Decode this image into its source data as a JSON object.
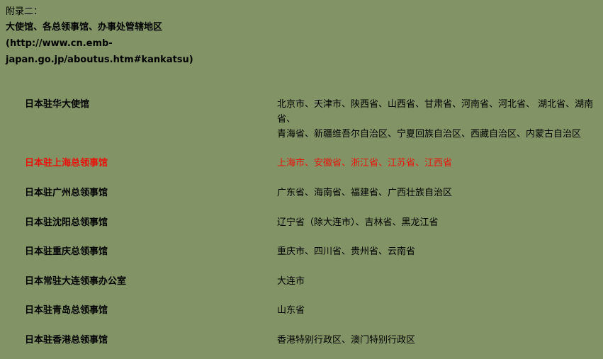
{
  "header": {
    "appendix_label": "附录二：",
    "title": "大使馆、各总领事馆、办事处管辖地区",
    "url_part1": "(http://www.cn.emb-",
    "url_part2": "japan.go.jp/aboutus.htm#kankatsu)"
  },
  "table": {
    "rows": [
      {
        "name": "日本驻华大使馆",
        "line1": "北京市、天津市、陕西省、山西省、甘肃省、河南省、河北省、 湖北省、湖南",
        "line2": "省、",
        "line3": "青海省、新疆维吾尔自治区、宁夏回族自治区、西藏自治区、内蒙古自治区"
      },
      {
        "name": "日本驻上海总领事馆",
        "line1": "上海市、安徽省、浙江省、江苏省、江西省",
        "highlighted": true
      },
      {
        "name": "日本驻广州总领事馆",
        "line1": "广东省、海南省、福建省、广西壮族自治区"
      },
      {
        "name": "日本驻沈阳总领事馆",
        "line1": "辽宁省（除大连市）、吉林省、黑龙江省"
      },
      {
        "name": "日本驻重庆总领事馆",
        "line1": "重庆市、四川省、贵州省、云南省"
      },
      {
        "name": "日本常驻大连领事办公室",
        "line1": "大连市"
      },
      {
        "name": "日本驻青岛总领事馆",
        "line1": "山东省"
      },
      {
        "name": "日本驻香港总领事馆",
        "line1": "香港特别行政区、澳门特别行政区"
      }
    ]
  },
  "colors": {
    "background": "#829466",
    "highlight": "#e8140c",
    "text": "#000000"
  }
}
